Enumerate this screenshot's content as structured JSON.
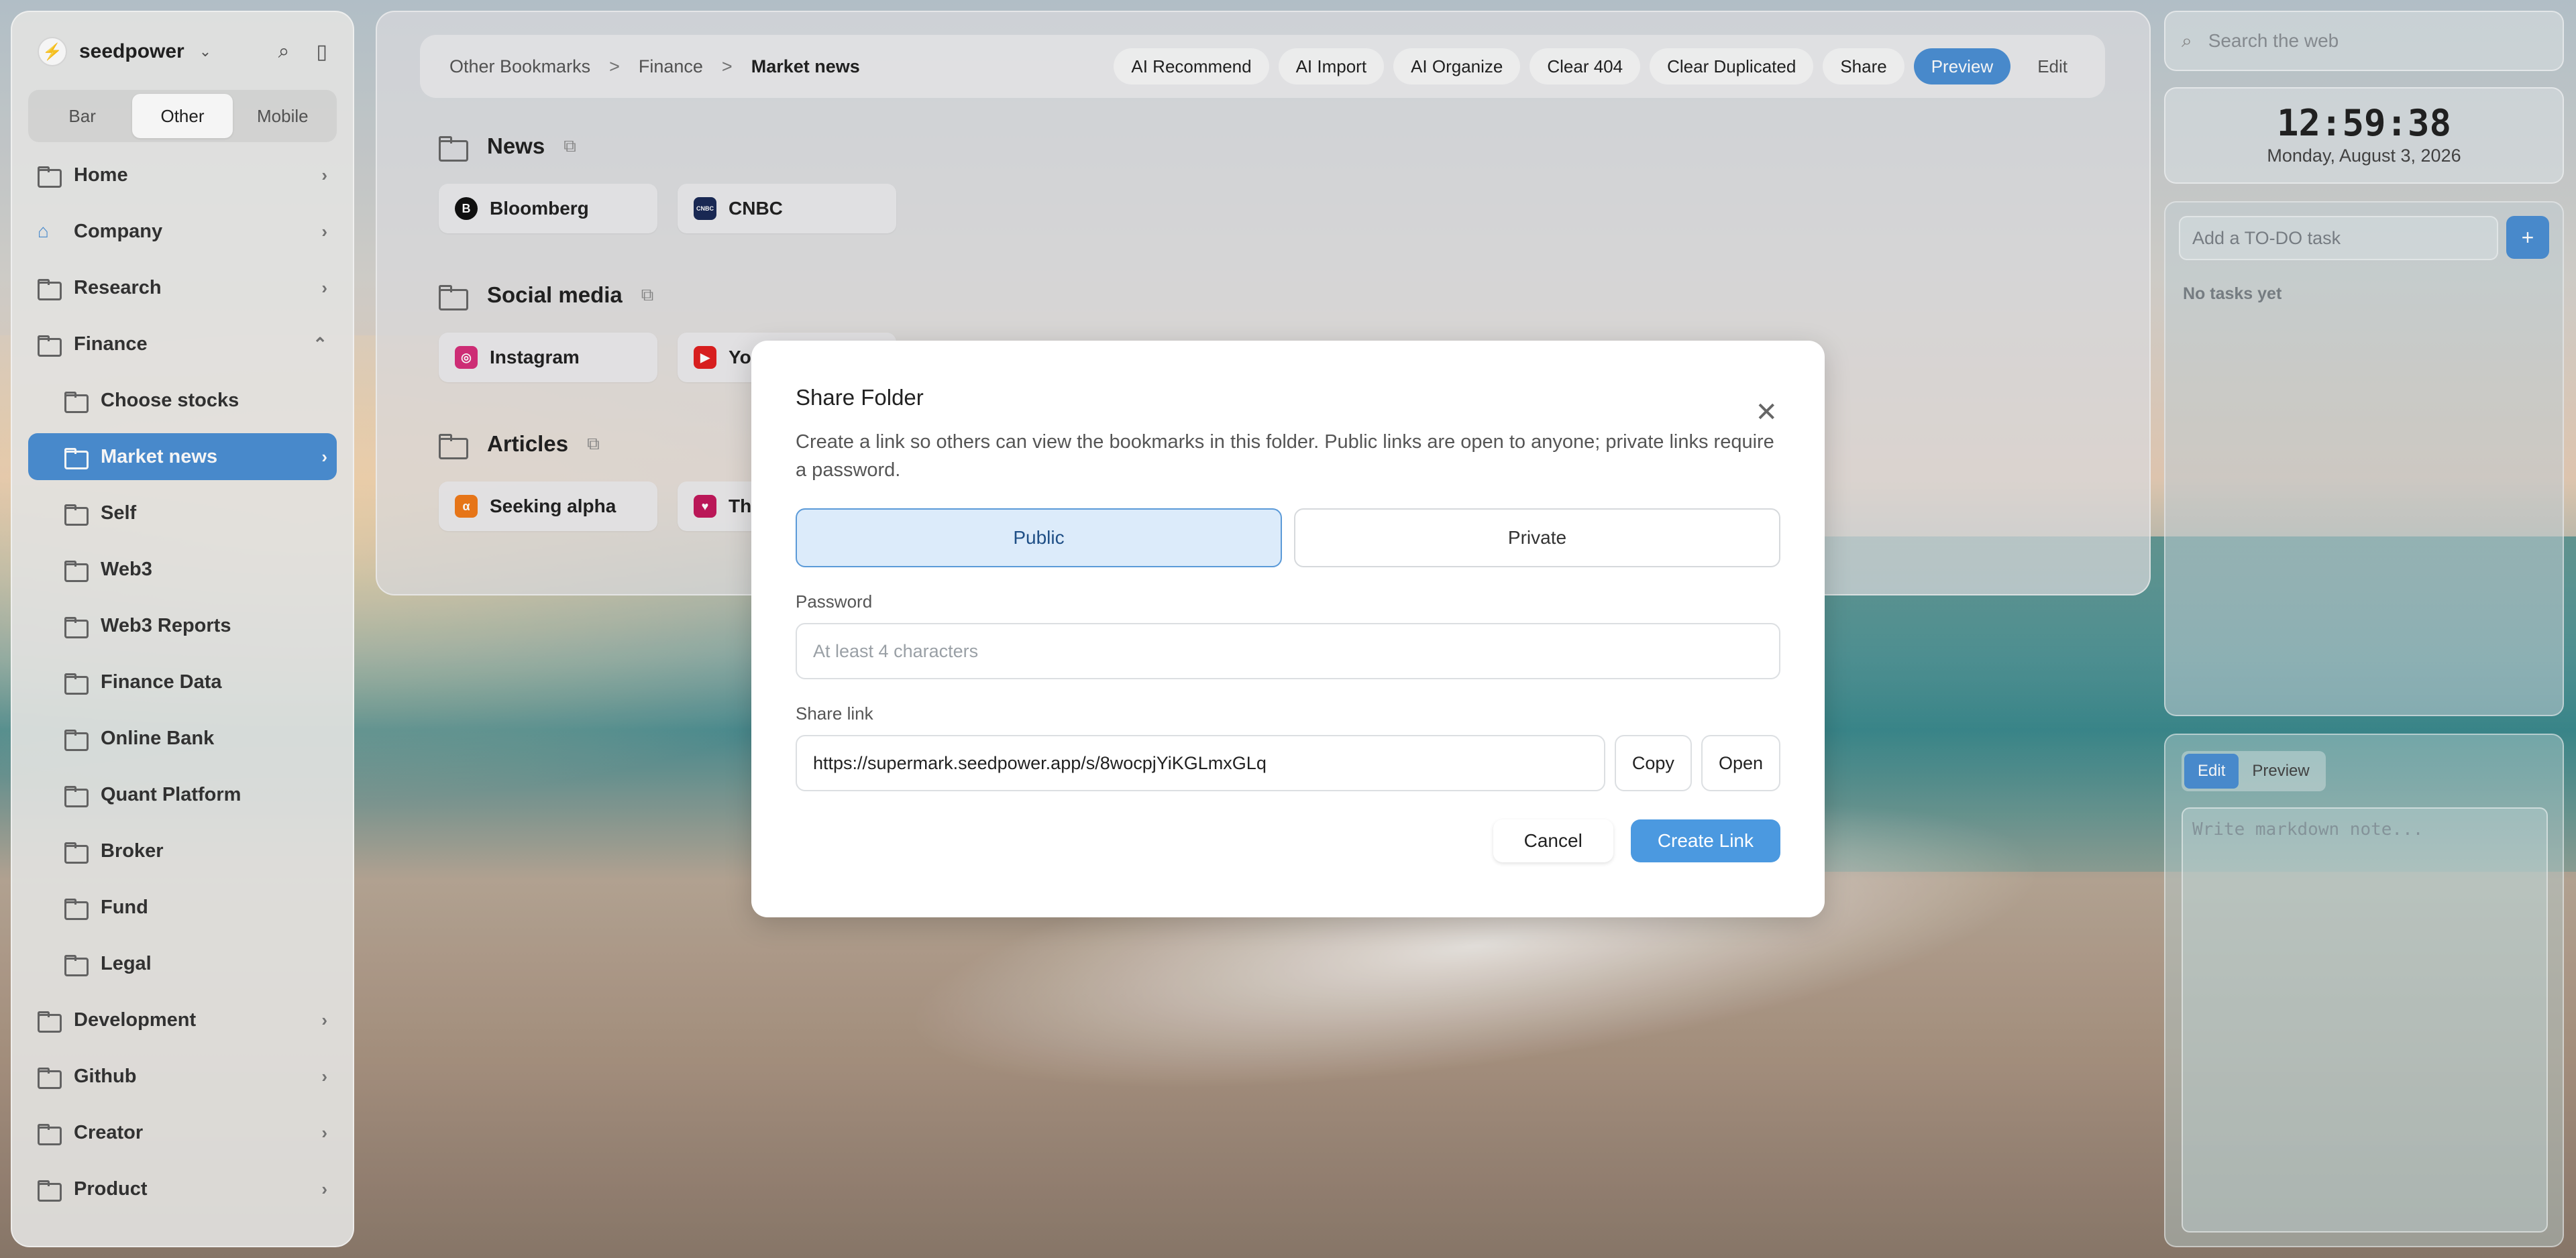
{
  "app": {
    "brand": "seedpower",
    "view_tabs": [
      "Bar",
      "Other",
      "Mobile"
    ],
    "active_view_tab": "Other"
  },
  "sidebar": {
    "items": [
      {
        "label": "Home",
        "level": 0,
        "expandable": true
      },
      {
        "label": "Company",
        "level": 0,
        "expandable": true,
        "icon": "home-icon"
      },
      {
        "label": "Research",
        "level": 0,
        "expandable": true
      },
      {
        "label": "Finance",
        "level": 0,
        "expandable": true,
        "expanded": true
      },
      {
        "label": "Choose stocks",
        "level": 1
      },
      {
        "label": "Market news",
        "level": 1,
        "active": true,
        "expandable": true
      },
      {
        "label": "Self",
        "level": 1
      },
      {
        "label": "Web3",
        "level": 1
      },
      {
        "label": "Web3 Reports",
        "level": 1
      },
      {
        "label": "Finance Data",
        "level": 1
      },
      {
        "label": "Online Bank",
        "level": 1
      },
      {
        "label": "Quant Platform",
        "level": 1
      },
      {
        "label": "Broker",
        "level": 1
      },
      {
        "label": "Fund",
        "level": 1
      },
      {
        "label": "Legal",
        "level": 1
      },
      {
        "label": "Development",
        "level": 0,
        "expandable": true
      },
      {
        "label": "Github",
        "level": 0,
        "expandable": true
      },
      {
        "label": "Creator",
        "level": 0,
        "expandable": true
      },
      {
        "label": "Product",
        "level": 0,
        "expandable": true
      }
    ]
  },
  "breadcrumb": [
    "Other Bookmarks",
    "Finance",
    "Market news"
  ],
  "breadcrumb_sep": ">",
  "toolbar": {
    "actions": [
      "AI Recommend",
      "AI Import",
      "AI Organize",
      "Clear 404",
      "Clear Duplicated",
      "Share"
    ],
    "preview": "Preview",
    "edit": "Edit"
  },
  "sections": [
    {
      "title": "News",
      "cards": [
        {
          "label": "Bloomberg",
          "fav": "B",
          "color": "#111111"
        },
        {
          "label": "CNBC",
          "fav": "CNBC",
          "color": "#1b2a57"
        }
      ]
    },
    {
      "title": "Social media",
      "cards": [
        {
          "label": "Instagram",
          "fav": "◎",
          "color": "#d62f7a"
        },
        {
          "label": "YouTube",
          "fav": "▶",
          "color": "#e02020"
        }
      ]
    },
    {
      "title": "Articles",
      "cards": [
        {
          "label": "Seeking alpha",
          "fav": "α",
          "color": "#f07a1a"
        },
        {
          "label": "The...",
          "fav": "♥",
          "color": "#c2185b"
        }
      ]
    }
  ],
  "search": {
    "placeholder": "Search the web"
  },
  "clock": {
    "time": "12:59:38",
    "date": "Monday, August 3, 2026"
  },
  "todo": {
    "placeholder": "Add a TO-DO task",
    "add": "+",
    "empty": "No tasks yet"
  },
  "notes": {
    "tabs": [
      "Edit",
      "Preview"
    ],
    "placeholder": "Write markdown note..."
  },
  "dialog": {
    "title": "Share Folder",
    "description": "Create a link so others can view the bookmarks in this folder. Public links are open to anyone; private links require a password.",
    "public": "Public",
    "private": "Private",
    "password_label": "Password",
    "password_placeholder": "At least 4 characters",
    "link_label": "Share link",
    "link_value": "https://supermark.seedpower.app/s/8wocpjYiKGLmxGLq",
    "copy": "Copy",
    "open": "Open",
    "cancel": "Cancel",
    "create": "Create Link"
  },
  "colors": {
    "accent": "#4b8fd4",
    "toggle_active_bg": "#dcebfa"
  }
}
